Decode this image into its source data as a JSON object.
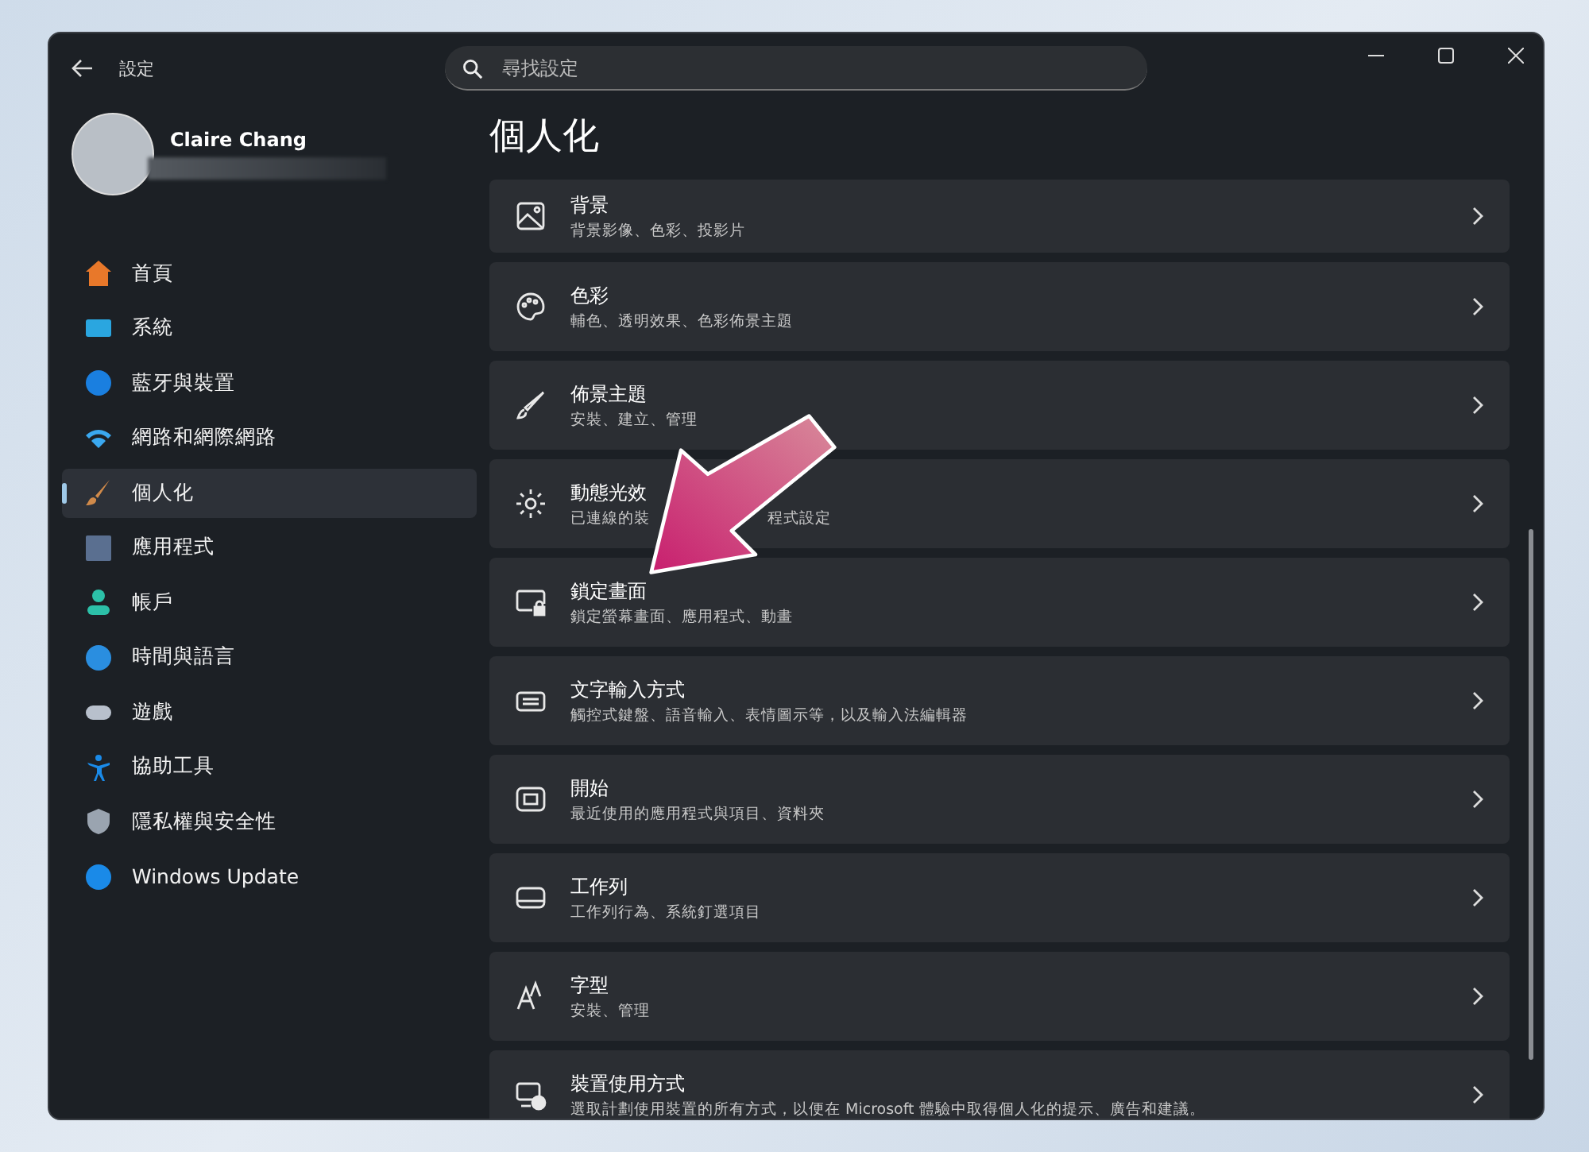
{
  "window": {
    "title": "設定"
  },
  "search": {
    "placeholder": "尋找設定"
  },
  "profile": {
    "name": "Claire Chang"
  },
  "sidebar": {
    "items": [
      {
        "label": "首頁",
        "selected": false
      },
      {
        "label": "系統",
        "selected": false
      },
      {
        "label": "藍牙與裝置",
        "selected": false
      },
      {
        "label": "網路和網際網路",
        "selected": false
      },
      {
        "label": "個人化",
        "selected": true
      },
      {
        "label": "應用程式",
        "selected": false
      },
      {
        "label": "帳戶",
        "selected": false
      },
      {
        "label": "時間與語言",
        "selected": false
      },
      {
        "label": "遊戲",
        "selected": false
      },
      {
        "label": "協助工具",
        "selected": false
      },
      {
        "label": "隱私權與安全性",
        "selected": false
      },
      {
        "label": "Windows Update",
        "selected": false
      }
    ]
  },
  "page": {
    "title": "個人化",
    "settings": [
      {
        "title": "背景",
        "subtitle": [
          "背景影像、色彩、投影片"
        ]
      },
      {
        "title": "色彩",
        "subtitle": [
          "輔色、透明效果、色彩佈景主題"
        ]
      },
      {
        "title": "佈景主題",
        "subtitle": [
          "安裝、建立、管理"
        ]
      },
      {
        "title": "動態光效",
        "subtitle": [
          "已連線的裝",
          "程式設定"
        ]
      },
      {
        "title": "鎖定畫面",
        "subtitle": [
          "鎖定螢幕畫面、應用程式、動畫"
        ]
      },
      {
        "title": "文字輸入方式",
        "subtitle": [
          "觸控式鍵盤、語音輸入、表情圖示等，以及輸入法編輯器"
        ]
      },
      {
        "title": "開始",
        "subtitle": [
          "最近使用的應用程式與項目、資料夾"
        ]
      },
      {
        "title": "工作列",
        "subtitle": [
          "工作列行為、系統釘選項目"
        ]
      },
      {
        "title": "字型",
        "subtitle": [
          "安裝、管理"
        ]
      },
      {
        "title": "裝置使用方式",
        "subtitle": [
          "選取計劃使用裝置的所有方式，以便在 Microsoft 體驗中取得個人化的提示、廣告和建議。"
        ]
      }
    ]
  }
}
